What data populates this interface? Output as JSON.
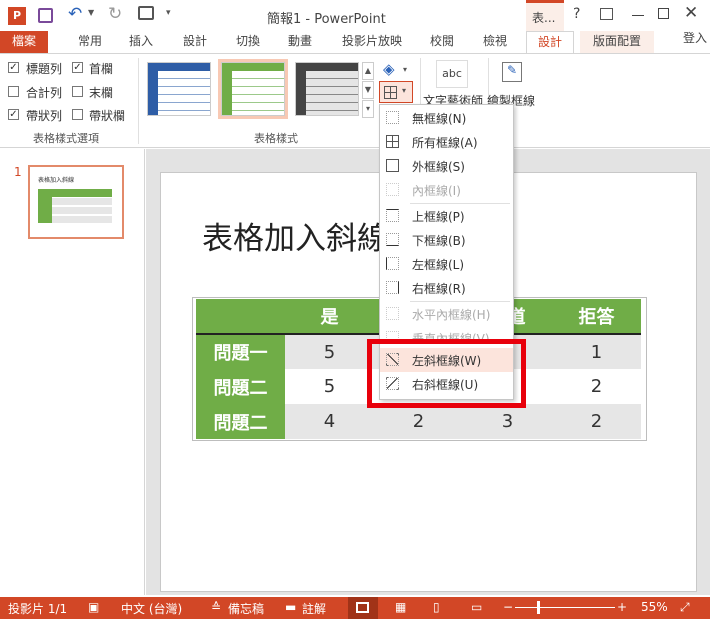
{
  "titlebar": {
    "title": "簡報1 - PowerPoint",
    "contextual_tab": "表...",
    "help": "?"
  },
  "tabs": [
    "檔案",
    "常用",
    "插入",
    "設計",
    "切換",
    "動畫",
    "投影片放映",
    "校閱",
    "檢視",
    "設計",
    "版面配置"
  ],
  "signin": "登入",
  "ribbon": {
    "options": {
      "header_row": "標題列",
      "first_column": "首欄",
      "total_row": "合計列",
      "last_column": "末欄",
      "banded_rows": "帶狀列",
      "banded_columns": "帶狀欄",
      "group_label": "表格樣式選項"
    },
    "styles_label": "表格樣式",
    "wordart": "文字藝術師",
    "draw_borders": "繪製框線",
    "abc": "abc"
  },
  "border_menu": [
    {
      "label": "無框線(N)",
      "disabled": false
    },
    {
      "label": "所有框線(A)",
      "disabled": false
    },
    {
      "label": "外框線(S)",
      "disabled": false
    },
    {
      "label": "內框線(I)",
      "disabled": true
    },
    {
      "label": "上框線(P)",
      "disabled": false
    },
    {
      "label": "下框線(B)",
      "disabled": false
    },
    {
      "label": "左框線(L)",
      "disabled": false
    },
    {
      "label": "右框線(R)",
      "disabled": false
    },
    {
      "label": "水平內框線(H)",
      "disabled": true
    },
    {
      "label": "垂直內框線(V)",
      "disabled": true
    },
    {
      "label": "左斜框線(W)",
      "disabled": false
    },
    {
      "label": "右斜框線(U)",
      "disabled": false
    }
  ],
  "thumbnail": {
    "number": "1",
    "title": "表格加入斜線"
  },
  "slide": {
    "title": "表格加入斜線",
    "table": {
      "header": [
        "",
        "是",
        "",
        "知道",
        "拒答"
      ],
      "rows": [
        [
          "問題一",
          "5",
          "",
          "",
          "1"
        ],
        [
          "問題二",
          "5",
          "",
          "",
          "2"
        ],
        [
          "問題二",
          "4",
          "2",
          "3",
          "2"
        ]
      ]
    }
  },
  "status": {
    "slide": "投影片 1/1",
    "lang": "中文 (台灣)",
    "notes": "備忘稿",
    "comments": "註解",
    "zoom": "55%"
  },
  "colors": {
    "accent": "#d24726",
    "table_green": "#70ad47",
    "highlight_red": "#e8000b"
  }
}
